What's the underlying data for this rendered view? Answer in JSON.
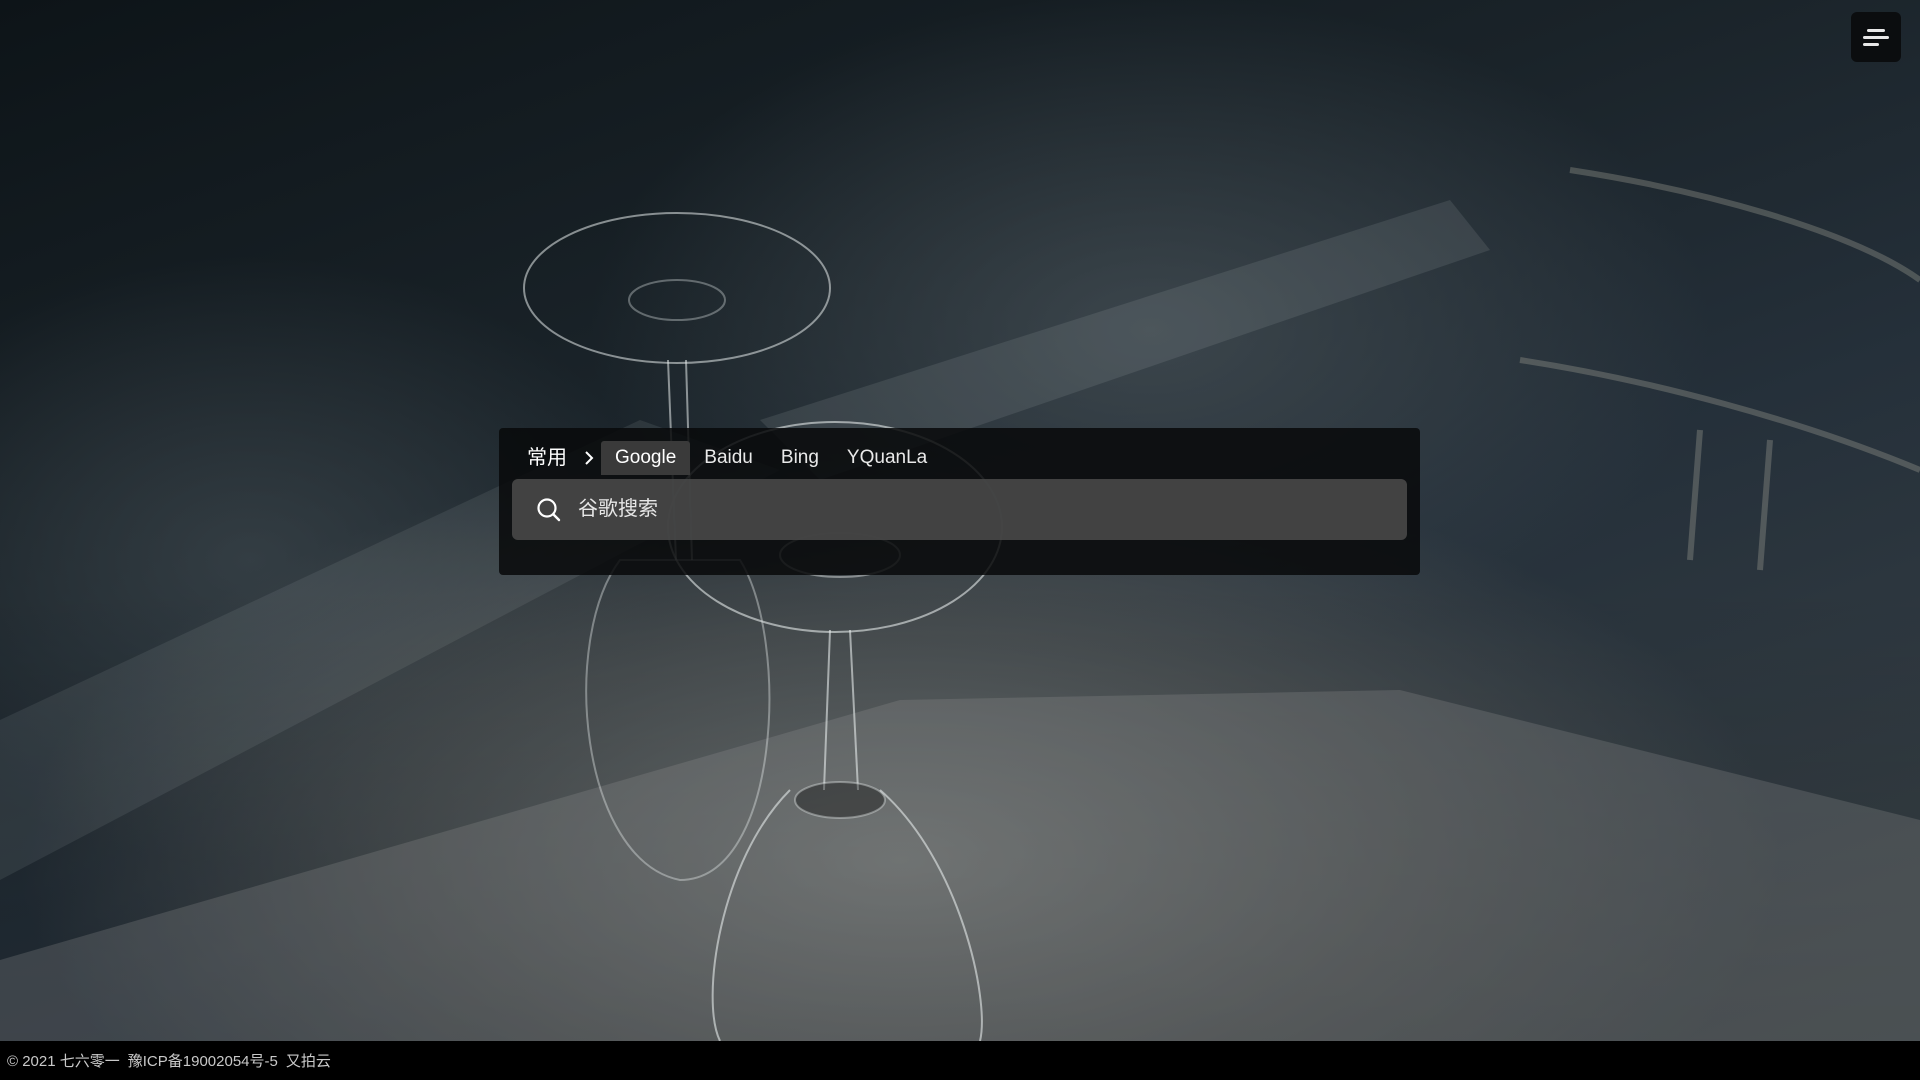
{
  "menu": {
    "icon": "hamburger-menu-icon"
  },
  "search": {
    "group_label": "常用",
    "engines": [
      "Google",
      "Baidu",
      "Bing",
      "YQuanLa"
    ],
    "active_engine": "Google",
    "placeholder": "谷歌搜索",
    "icon": "search-icon"
  },
  "footer": {
    "copyright": "© 2021 七六零一",
    "icp": "豫ICP备19002054号-5",
    "host": "又拍云"
  },
  "colors": {
    "panel_bg": "#08090a",
    "active_tab_bg": "#3a3a3a",
    "input_bg": "#484848",
    "footer_bg": "#000000"
  }
}
